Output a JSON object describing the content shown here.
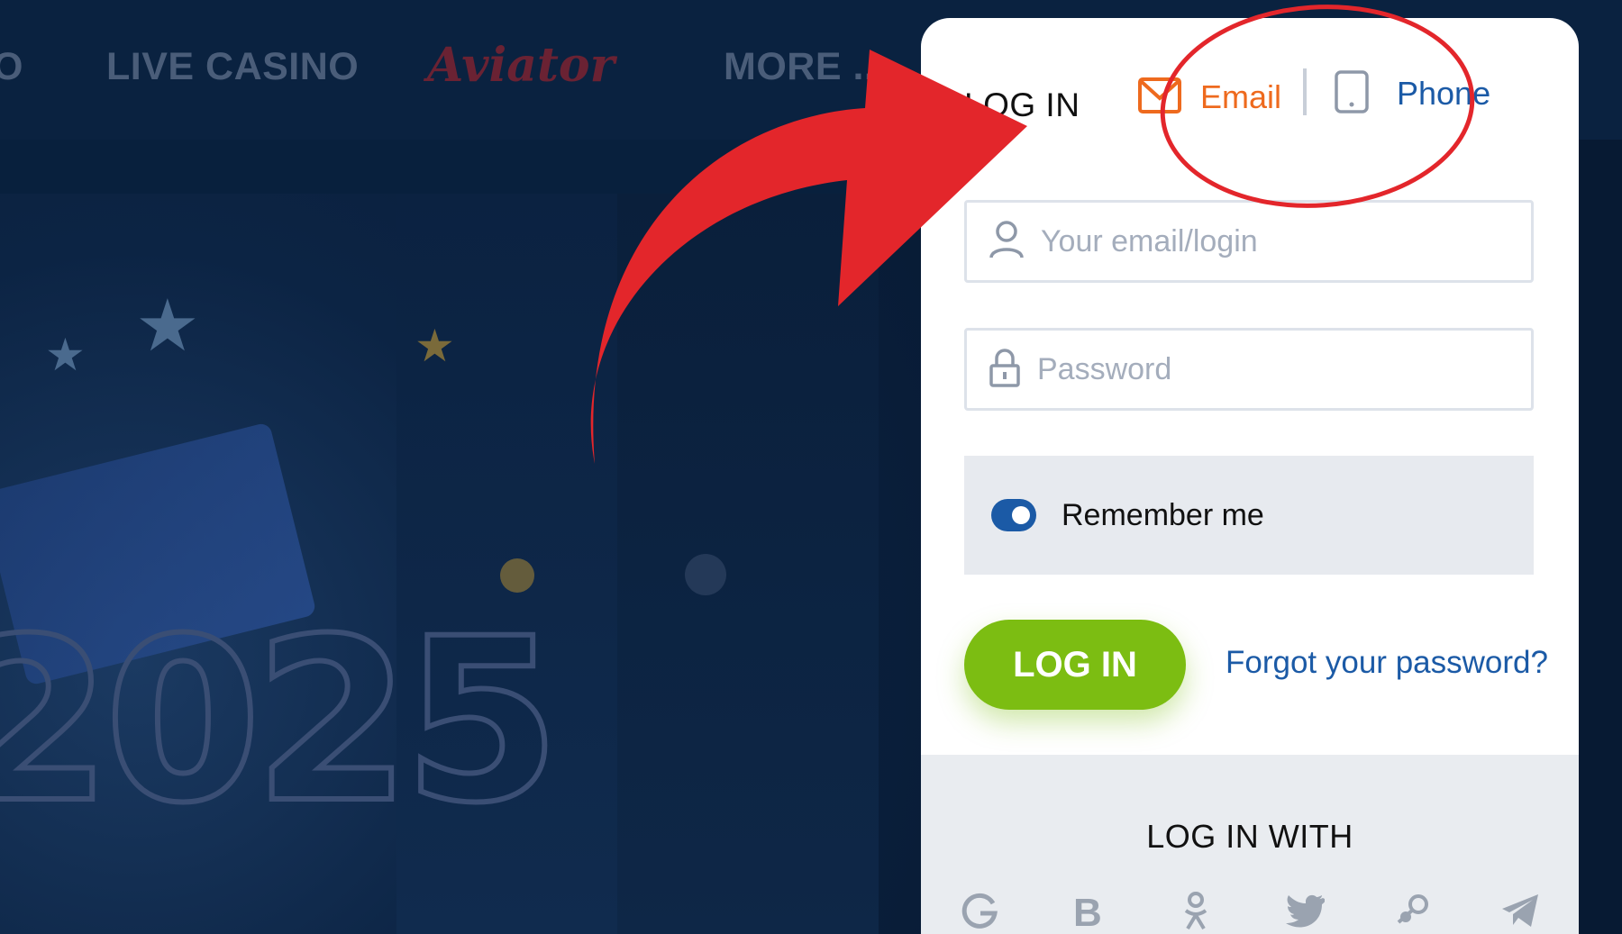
{
  "nav": {
    "items": [
      "O",
      "LIVE CASINO",
      "Aviator",
      "MORE ..."
    ]
  },
  "banner": {
    "year": "2025"
  },
  "login": {
    "title": "LOG IN",
    "tabs": {
      "email": "Email",
      "phone": "Phone"
    },
    "email_placeholder": "Your email/login",
    "password_placeholder": "Password",
    "remember_label": "Remember me",
    "remember_checked": true,
    "submit_label": "LOG IN",
    "forgot_label": "Forgot your password?",
    "social_title": "LOG IN WITH",
    "social_icons": [
      "google-icon",
      "b-icon",
      "odnoklassniki-icon",
      "twitter-icon",
      "steam-icon",
      "telegram-icon"
    ]
  },
  "colors": {
    "accent_orange": "#ee6a1e",
    "accent_blue": "#1b5aa6",
    "button_green": "#7cbd12",
    "annotation_red": "#e3262b"
  }
}
